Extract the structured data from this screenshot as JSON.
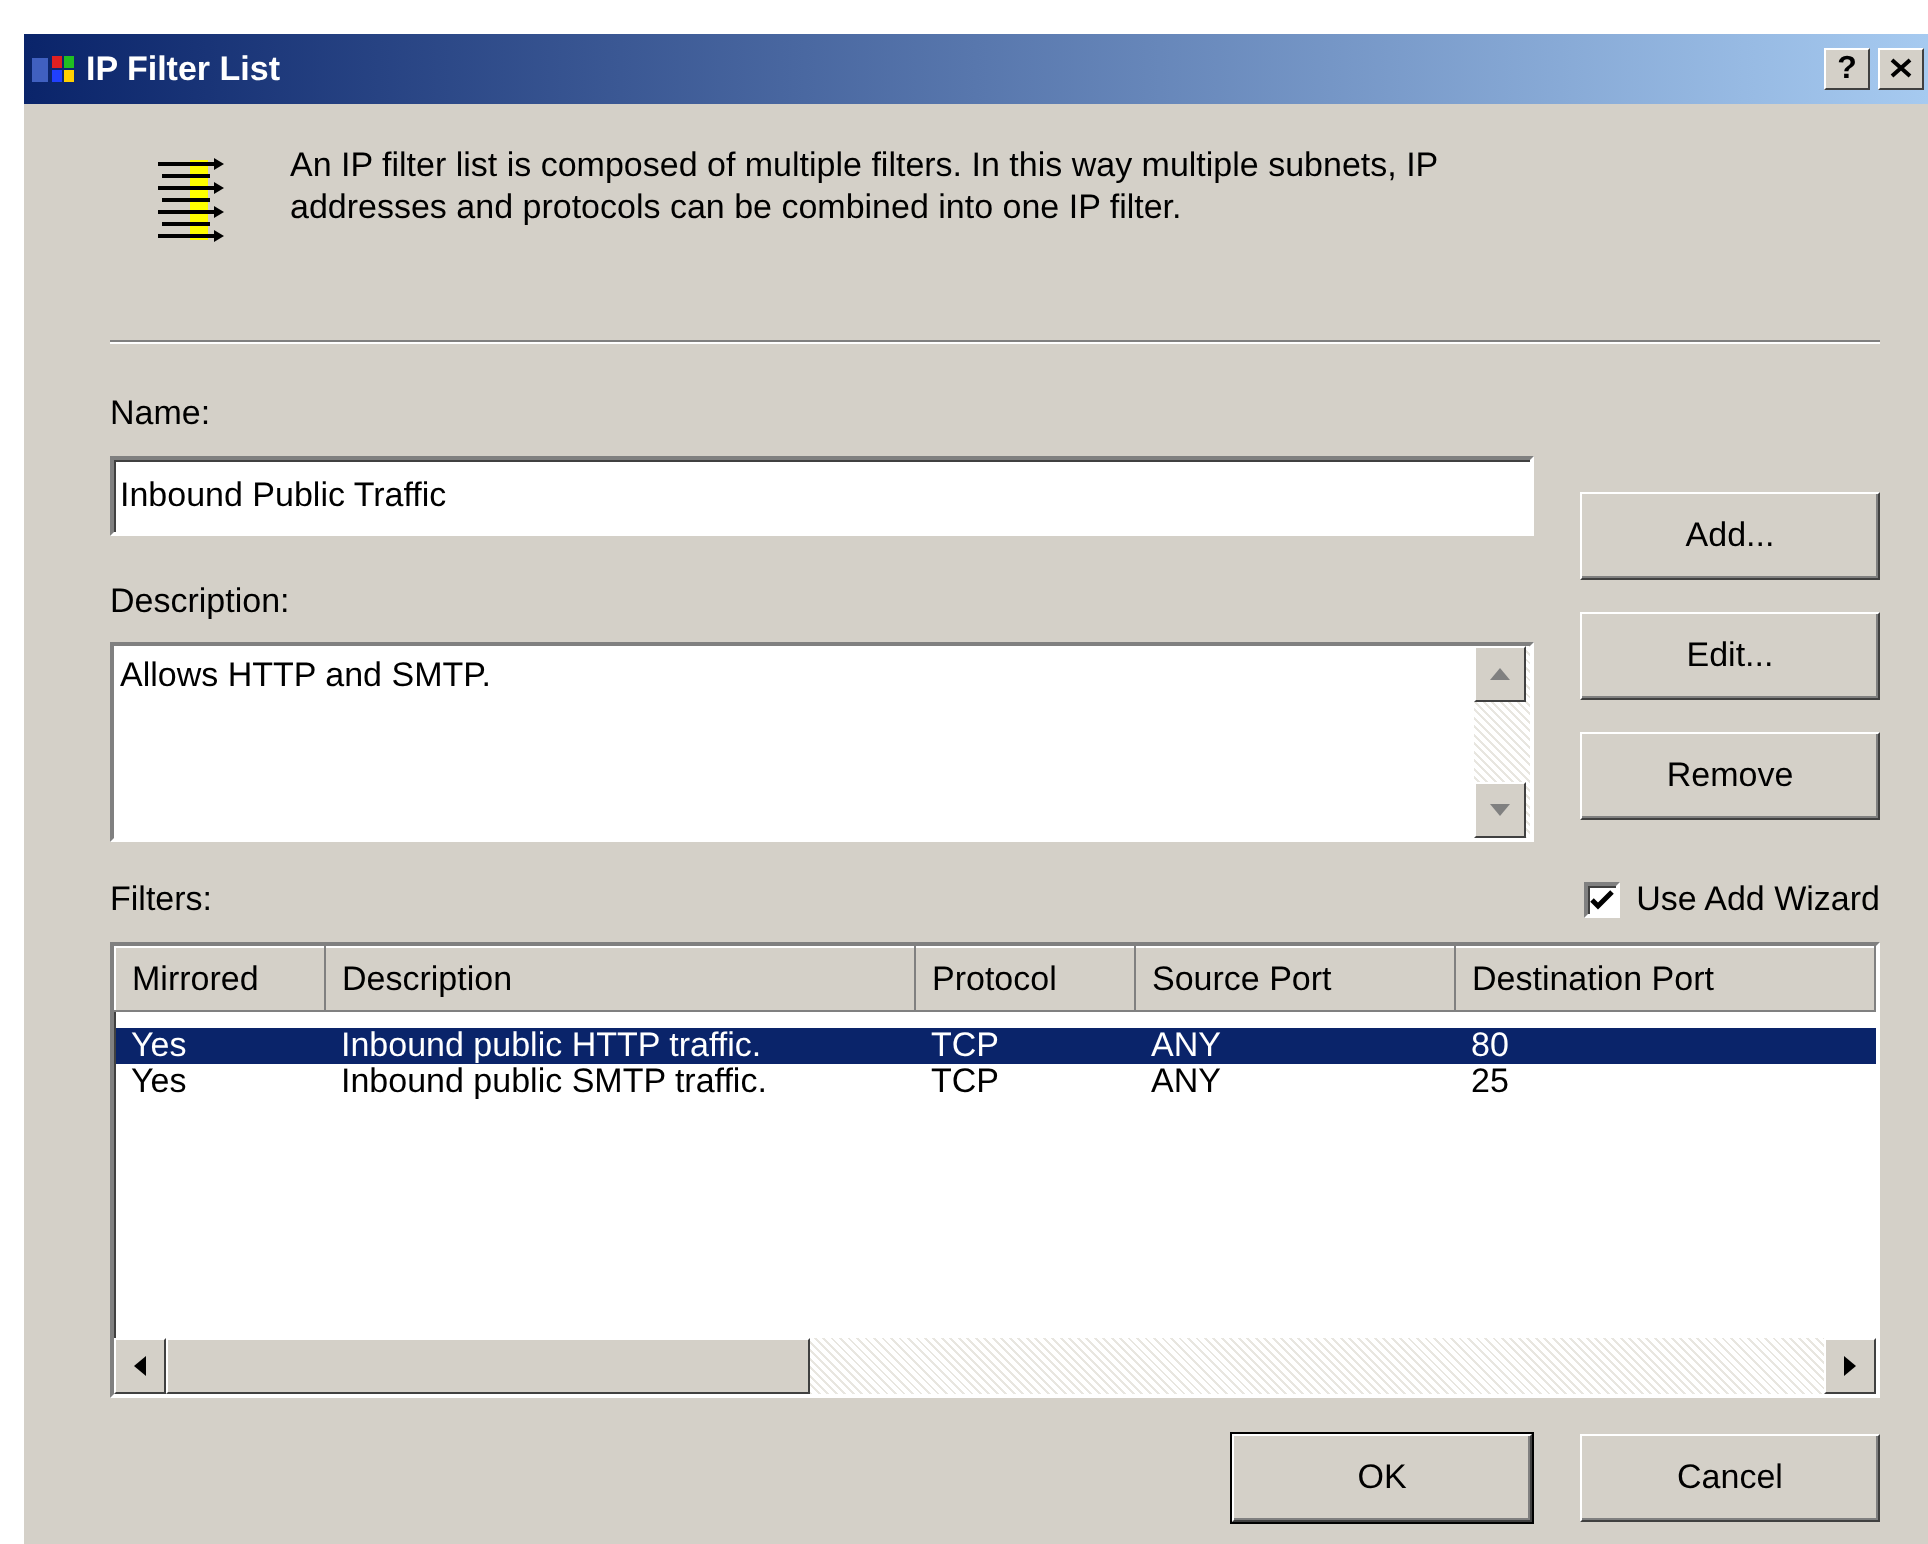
{
  "window": {
    "title": "IP Filter List",
    "help_button": "?"
  },
  "intro": "An IP filter list is composed of multiple filters. In this way multiple subnets, IP addresses and protocols can be combined into one IP filter.",
  "name": {
    "label": "Name:",
    "value": "Inbound Public Traffic"
  },
  "description": {
    "label": "Description:",
    "value": "Allows HTTP and SMTP."
  },
  "side_buttons": [
    "Add...",
    "Edit...",
    "Remove"
  ],
  "filters": {
    "label": "Filters:",
    "use_add_wizard": {
      "label": "Use Add Wizard",
      "checked": true
    },
    "columns": [
      "Mirrored",
      "Description",
      "Protocol",
      "Source Port",
      "Destination Port"
    ],
    "rows": [
      {
        "cells": [
          "Yes",
          "Inbound public HTTP traffic.",
          "TCP",
          "ANY",
          "80"
        ],
        "selected": true
      },
      {
        "cells": [
          "Yes",
          "Inbound public SMTP traffic.",
          "TCP",
          "ANY",
          "25"
        ],
        "selected": false
      }
    ]
  },
  "buttons": [
    "OK",
    "Cancel"
  ]
}
